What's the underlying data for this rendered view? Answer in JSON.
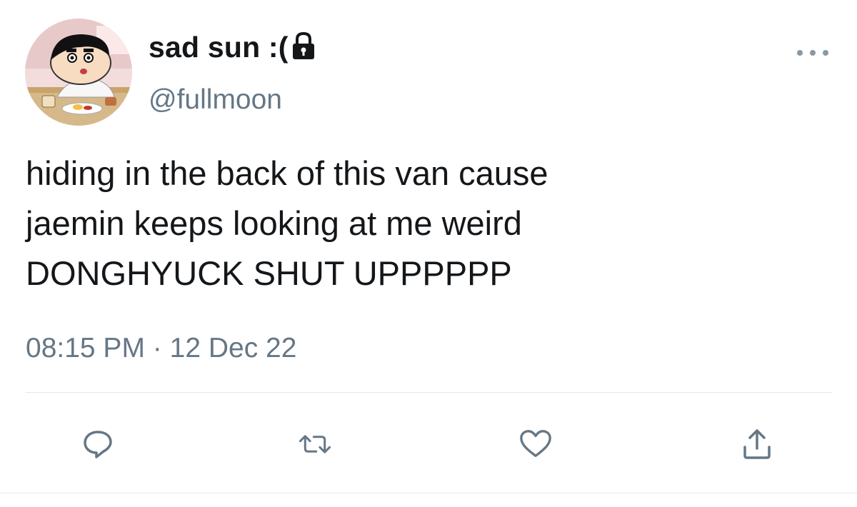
{
  "tweet": {
    "display_name": "sad sun :(",
    "handle": "@fullmoon",
    "text": "hiding in the back of this van cause\njaemin keeps looking at me weird\nDONGHYUCK SHUT UPPPPPP",
    "time": "08:15 PM",
    "separator": "·",
    "date": "12 Dec 22",
    "protected_icon": "lock-icon",
    "avatar_description_icon": "cartoon-avatar"
  },
  "actions": [
    {
      "icon": "reply-icon"
    },
    {
      "icon": "retweet-icon"
    },
    {
      "icon": "like-icon"
    },
    {
      "icon": "share-icon"
    }
  ],
  "colors": {
    "text_primary": "#14171a",
    "text_secondary": "#657786",
    "icon_gray": "#657786",
    "divider": "#e1e8ed"
  }
}
